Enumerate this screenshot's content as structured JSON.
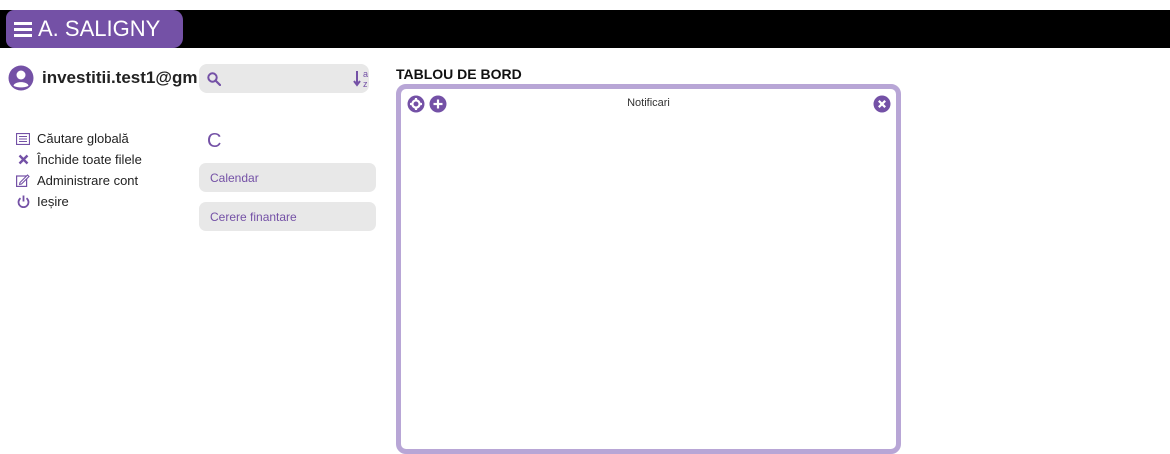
{
  "header": {
    "brand": "A. SALIGNY"
  },
  "user": {
    "email": "investitii.test1@gm"
  },
  "search": {
    "placeholder": "",
    "value": ""
  },
  "menu": [
    {
      "label": "Căutare globală",
      "icon": "list-icon"
    },
    {
      "label": "Închide toate filele",
      "icon": "close-x-icon"
    },
    {
      "label": "Administrare cont",
      "icon": "edit-icon"
    },
    {
      "label": "Ieșire",
      "icon": "power-icon"
    }
  ],
  "refresh_glyph": "C",
  "panels": [
    {
      "label": "Calendar"
    },
    {
      "label": "Cerere finantare"
    }
  ],
  "dashboard": {
    "title": "TABLOU DE BORD",
    "widget_title": "Notificari"
  },
  "colors": {
    "accent": "#7451a6",
    "frame": "#b8a6d6",
    "topbar": "#000000",
    "field": "#e8e8e8"
  }
}
